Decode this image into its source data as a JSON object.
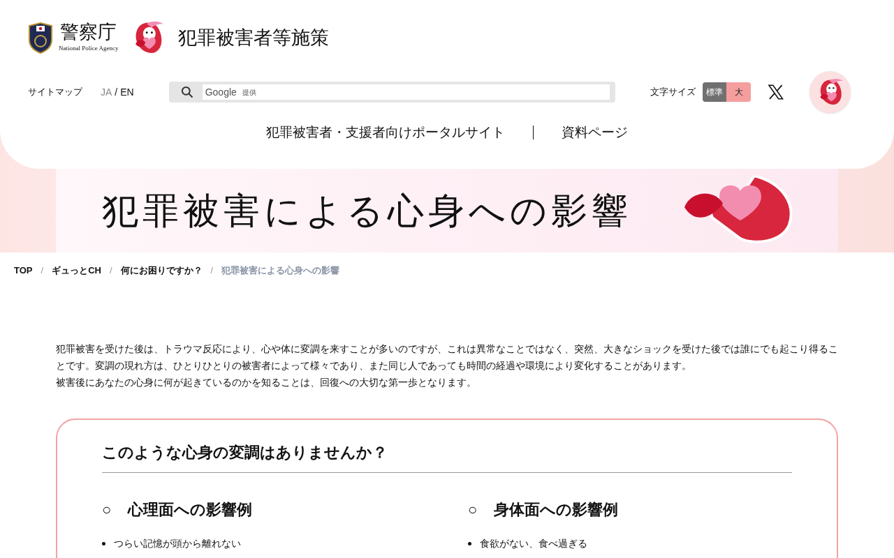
{
  "header": {
    "agency_name": "警察庁",
    "agency_name_en": "National Police Agency",
    "site_title": "犯罪被害者等施策",
    "sitemap": "サイトマップ",
    "languages": [
      {
        "label": "JA",
        "selected": false
      },
      {
        "label": "EN",
        "selected": true
      }
    ],
    "language_separator": "/",
    "search": {
      "brand": "Google",
      "suffix": "提供"
    },
    "font_size": {
      "label": "文字サイズ",
      "options": [
        {
          "label": "標準",
          "selected": true
        },
        {
          "label": "大",
          "selected": false
        }
      ]
    },
    "nav": [
      "犯罪被害者・支援者向けポータルサイト",
      "資料ページ"
    ]
  },
  "hero": {
    "title": "犯罪被害による心身への影響"
  },
  "breadcrumb": {
    "items": [
      "TOP",
      "ギュっとCH",
      "何にお困りですか？",
      "犯罪被害による心身への影響"
    ],
    "separators": [
      "/",
      "/",
      "/"
    ]
  },
  "intro": [
    "犯罪被害を受けた後は、トラウマ反応により、心や体に変調を来すことが多いのですが、これは異常なことではなく、突然、大きなショックを受けた後では誰にでも起こり得ることです。変調の現れ方は、ひとりひとりの被害者によって様々であり、また同じ人であっても時間の経過や環境により変化することがあります。",
    "被害後にあなたの心身に何が起きているのかを知ることは、回復への大切な第一歩となります。"
  ],
  "card": {
    "title": "このような心身の変調はありませんか？",
    "columns": [
      {
        "marker": "○",
        "heading": "心理面への影響例",
        "items": [
          "つらい記憶が頭から離れない"
        ]
      },
      {
        "marker": "○",
        "heading": "身体面への影響例",
        "items": [
          "食欲がない、食べ過ぎる"
        ]
      }
    ]
  }
}
